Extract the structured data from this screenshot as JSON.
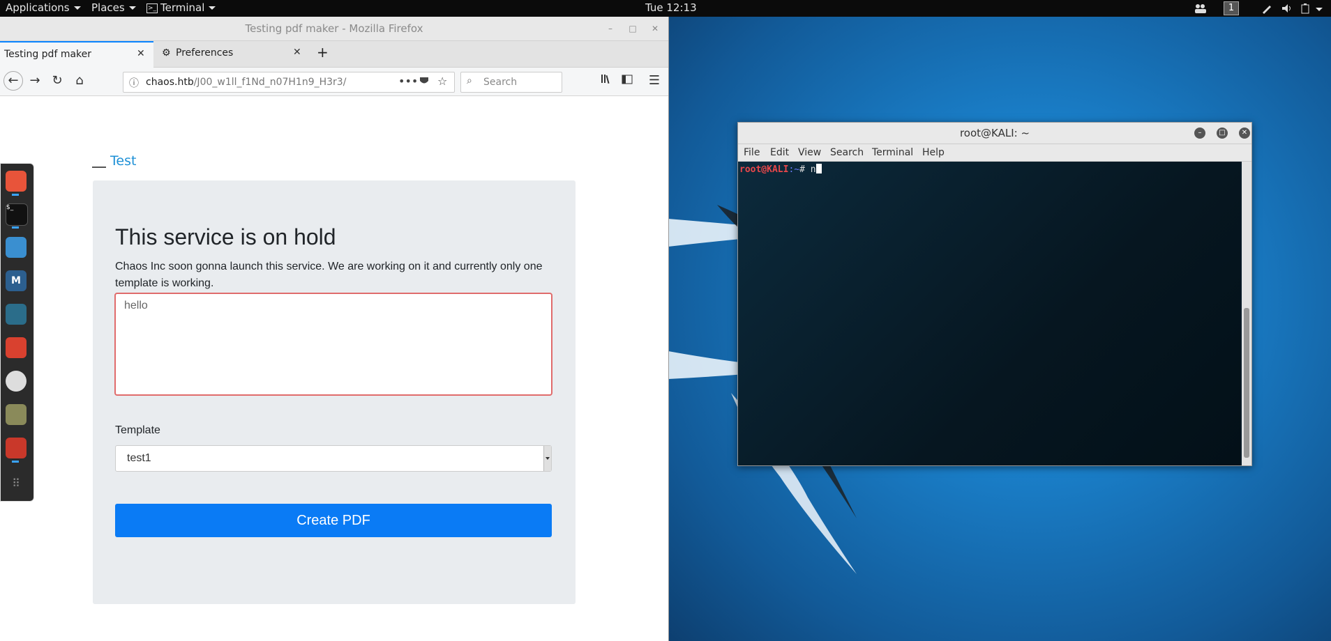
{
  "topbar": {
    "applications": "Applications",
    "places": "Places",
    "terminal": "Terminal",
    "clock": "Tue 12:13",
    "workspace": "1"
  },
  "firefox": {
    "window_title": "Testing pdf maker - Mozilla Firefox",
    "tabs": [
      {
        "label": "Testing pdf maker",
        "active": true
      },
      {
        "label": "Preferences",
        "active": false
      }
    ],
    "url_host": "chaos.htb",
    "url_path": "/J00_w1ll_f1Nd_n07H1n9_H3r3/",
    "search_placeholder": "Search"
  },
  "page": {
    "brand": "Test",
    "title": "This service is on hold",
    "description": "Chaos Inc soon gonna launch this service. We are working on it and currently only one template is working.",
    "textarea_value": "hello",
    "template_label": "Template",
    "template_selected": "test1",
    "create_button": "Create PDF"
  },
  "terminal": {
    "window_title": "root@KALI: ~",
    "menu": [
      "File",
      "Edit",
      "View",
      "Search",
      "Terminal",
      "Help"
    ],
    "prompt_user": "root@KALI",
    "prompt_path": ":~",
    "prompt_symbol": "# ",
    "typed": "n"
  },
  "dock": [
    "firefox-icon",
    "terminal-icon",
    "files-icon",
    "metasploit-icon",
    "user-icon",
    "burp-icon",
    "maltego-icon",
    "notes-icon",
    "cherrytree-icon",
    "app-grid-icon"
  ]
}
